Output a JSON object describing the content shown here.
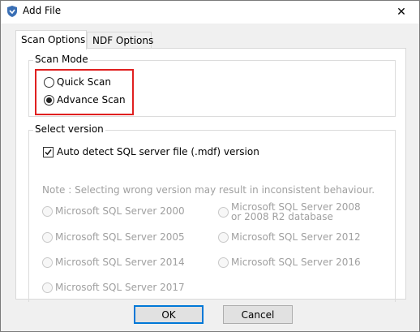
{
  "window": {
    "title": "Add File",
    "close_glyph": "✕"
  },
  "tabs": [
    {
      "label": "Scan Options",
      "active": true
    },
    {
      "label": "NDF Options",
      "active": false
    }
  ],
  "scan_mode": {
    "caption": "Scan Mode",
    "options": [
      {
        "label": "Quick Scan",
        "checked": false
      },
      {
        "label": "Advance Scan",
        "checked": true
      }
    ],
    "highlight_color": "#e02020"
  },
  "select_version": {
    "caption": "Select version",
    "auto_detect": {
      "label": "Auto detect SQL server file (.mdf) version",
      "checked": true
    },
    "note": "Note : Selecting wrong version may result in inconsistent behaviour.",
    "versions": [
      {
        "label": "Microsoft SQL Server 2000"
      },
      {
        "label_line1": "Microsoft SQL Server 2008",
        "label_line2": "or 2008 R2 database"
      },
      {
        "label": "Microsoft SQL Server 2005"
      },
      {
        "label": "Microsoft SQL Server 2012"
      },
      {
        "label": "Microsoft SQL Server 2014"
      },
      {
        "label": "Microsoft SQL Server 2016"
      },
      {
        "label": "Microsoft SQL Server 2017"
      }
    ]
  },
  "buttons": {
    "ok": "OK",
    "cancel": "Cancel"
  },
  "colors": {
    "accent": "#0078d7",
    "disabled_text": "#a0a0a0",
    "dialog_bg": "#f0f0f0"
  },
  "icons": {
    "app": "app-logo-icon",
    "close": "close-icon",
    "check": "checkmark-icon"
  }
}
